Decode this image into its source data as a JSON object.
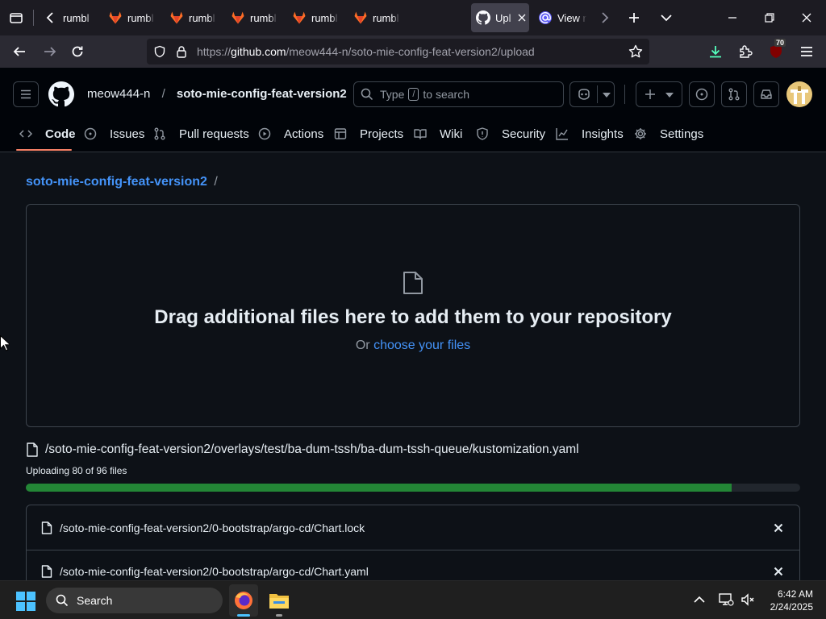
{
  "browser": {
    "tabs": [
      {
        "label": "rumbl",
        "icon": "gitlab-icon"
      },
      {
        "label": "rumbl",
        "icon": "gitlab-icon"
      },
      {
        "label": "rumbl",
        "icon": "gitlab-icon"
      },
      {
        "label": "rumbl",
        "icon": "gitlab-icon"
      },
      {
        "label": "rumbl",
        "icon": "gitlab-icon"
      },
      {
        "label": "rumbl",
        "icon": "gitlab-icon"
      },
      {
        "label": "Upl",
        "icon": "github-icon",
        "active": true
      },
      {
        "label": "View r",
        "icon": "at-icon"
      }
    ],
    "url_prefix": "https://",
    "url_host": "github.com",
    "url_path": "/meow444-n/soto-mie-config-feat-version2/upload",
    "extension_badge": "70"
  },
  "github": {
    "owner": "meow444-n",
    "separator": "/",
    "repo": "soto-mie-config-feat-version2",
    "search_prefix": "Type",
    "search_key": "/",
    "search_suffix": "to search",
    "nav": [
      {
        "label": "Code",
        "icon": "code-icon",
        "selected": true
      },
      {
        "label": "Issues",
        "icon": "issue-icon"
      },
      {
        "label": "Pull requests",
        "icon": "pull-request-icon"
      },
      {
        "label": "Actions",
        "icon": "play-icon"
      },
      {
        "label": "Projects",
        "icon": "table-icon"
      },
      {
        "label": "Wiki",
        "icon": "book-icon"
      },
      {
        "label": "Security",
        "icon": "shield-icon"
      },
      {
        "label": "Insights",
        "icon": "graph-icon"
      },
      {
        "label": "Settings",
        "icon": "gear-icon"
      }
    ],
    "accent": "#f78166",
    "link_color": "#4493f8"
  },
  "upload": {
    "breadcrumb_repo": "soto-mie-config-feat-version2",
    "breadcrumb_sep": "/",
    "drop_title": "Drag additional files here to add them to your repository",
    "drop_or": "Or",
    "drop_link": "choose your files",
    "current_file": "/soto-mie-config-feat-version2/overlays/test/ba-dum-tssh/ba-dum-tssh-queue/kustomization.yaml",
    "status": "Uploading 80 of 96 files",
    "progress_fraction": 0.911,
    "progress_color": "#238636",
    "files": [
      "/soto-mie-config-feat-version2/0-bootstrap/argo-cd/Chart.lock",
      "/soto-mie-config-feat-version2/0-bootstrap/argo-cd/Chart.yaml"
    ]
  },
  "taskbar": {
    "search_label": "Search",
    "time": "6:42 AM",
    "date": "2/24/2025"
  }
}
